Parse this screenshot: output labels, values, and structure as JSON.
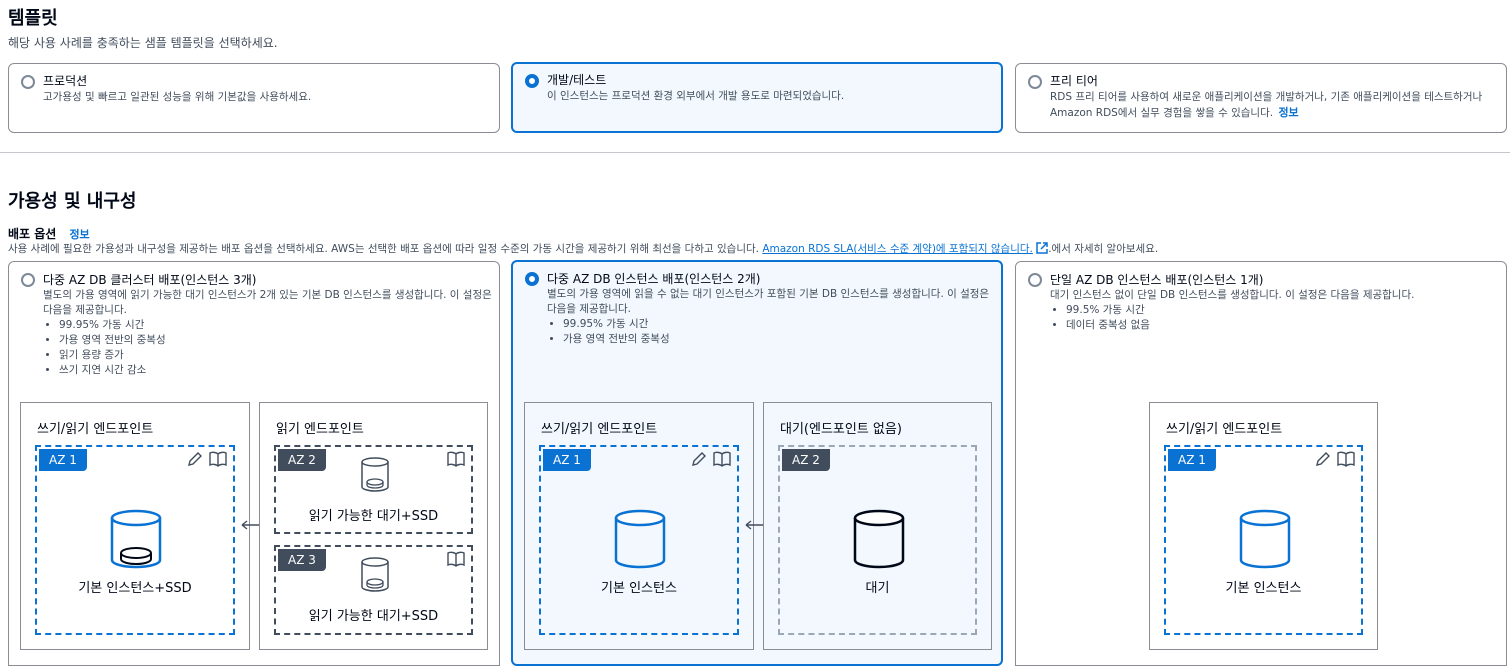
{
  "templates": {
    "title": "템플릿",
    "description": "해당 사용 사례를 충족하는 샘플 템플릿을 선택하세요.",
    "options": [
      {
        "title": "프로덕션",
        "desc": "고가용성 및 빠르고 일관된 성능을 위해 기본값을 사용하세요.",
        "selected": false
      },
      {
        "title": "개발/테스트",
        "desc": "이 인스턴스는 프로덕션 환경 외부에서 개발 용도로 마련되었습니다.",
        "selected": true
      },
      {
        "title": "프리 티어",
        "desc": "RDS 프리 티어를 사용하여 새로운 애플리케이션을 개발하거나, 기존 애플리케이션을 테스트하거나 Amazon RDS에서 실무 경험을 쌓을 수 있습니다.",
        "info": "정보",
        "selected": false
      }
    ]
  },
  "availability": {
    "title": "가용성 및 내구성",
    "deploy_label": "배포 옵션",
    "info": "정보",
    "desc_prefix": "사용 사례에 필요한 가용성과 내구성을 제공하는 배포 옵션을 선택하세요. AWS는 선택한 배포 옵션에 따라 일정 수준의 가동 시간을 제공하기 위해 최선을 다하고 있습니다.",
    "desc_link": "Amazon RDS SLA(서비스 수준 계약)에 포함되지 않습니다.",
    "desc_suffix": ".에서 자세히 알아보세요.",
    "options": [
      {
        "title": "다중 AZ DB 클러스터 배포(인스턴스 3개)",
        "desc": "별도의 가용 영역에 읽기 가능한 대기 인스턴스가 2개 있는 기본 DB 인스턴스를 생성합니다. 이 설정은 다음을 제공합니다.",
        "bullets": [
          "99.95% 가동 시간",
          "가용 영역 전반의 중복성",
          "읽기 용량 증가",
          "쓰기 지연 시간 감소"
        ],
        "selected": false,
        "diagram": {
          "rw_endpoint": "쓰기/읽기 엔드포인트",
          "read_endpoint": "읽기 엔드포인트",
          "az1": "AZ 1",
          "az2": "AZ 2",
          "az3": "AZ 3",
          "primary": "기본 인스턴스+SSD",
          "standby": "읽기 가능한 대기+SSD"
        }
      },
      {
        "title": "다중 AZ DB 인스턴스 배포(인스턴스 2개)",
        "desc": "별도의 가용 영역에 읽을 수 없는 대기 인스턴스가 포함된 기본 DB 인스턴스를 생성합니다. 이 설정은 다음을 제공합니다.",
        "bullets": [
          "99.95% 가동 시간",
          "가용 영역 전반의 중복성"
        ],
        "selected": true,
        "diagram": {
          "rw_endpoint": "쓰기/읽기 엔드포인트",
          "standby_endpoint": "대기(엔드포인트 없음)",
          "az1": "AZ 1",
          "az2": "AZ 2",
          "primary": "기본 인스턴스",
          "standby": "대기"
        }
      },
      {
        "title": "단일 AZ DB 인스턴스 배포(인스턴스 1개)",
        "desc": "대기 인스턴스 없이 단일 DB 인스턴스를 생성합니다. 이 설정은 다음을 제공합니다.",
        "bullets": [
          "99.5% 가동 시간",
          "데이터 중복성 없음"
        ],
        "selected": false,
        "diagram": {
          "rw_endpoint": "쓰기/읽기 엔드포인트",
          "az1": "AZ 1",
          "primary": "기본 인스턴스"
        }
      }
    ]
  },
  "colors": {
    "accent": "#0972d3",
    "selected_bg": "#f2f8fd",
    "dark_tag": "#414d5c"
  }
}
